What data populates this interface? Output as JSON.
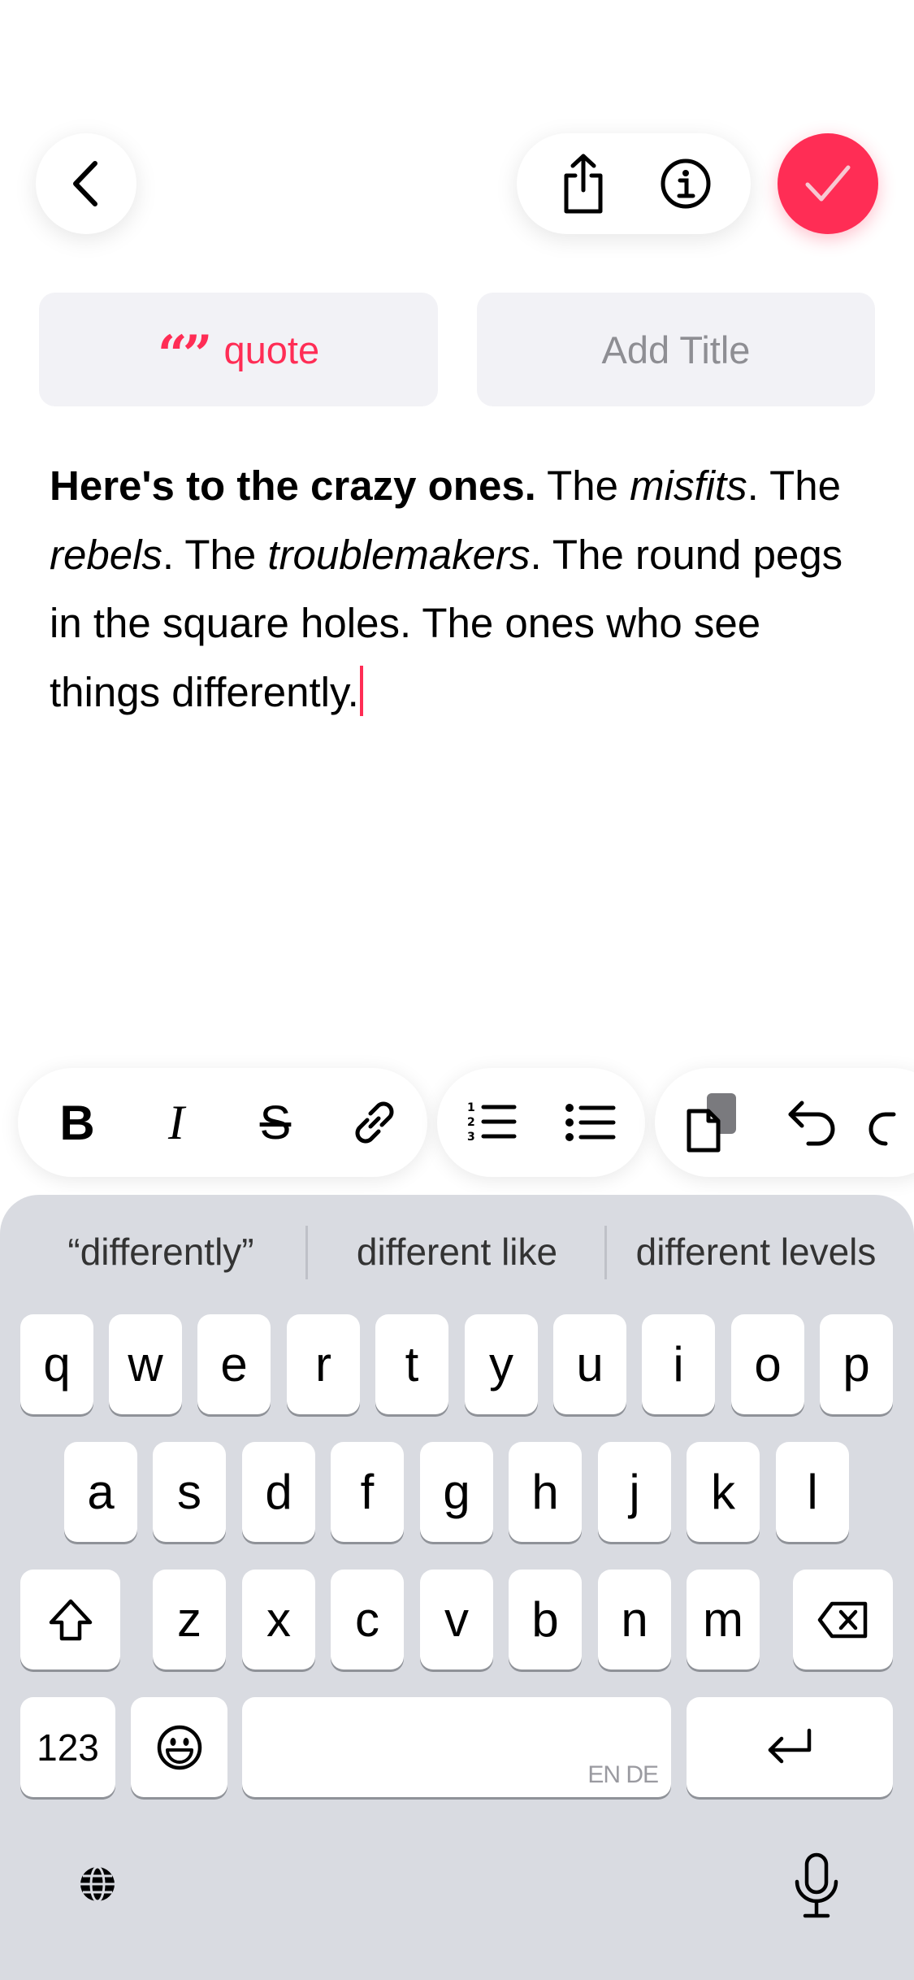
{
  "header": {
    "back_icon": "chevron-left-icon",
    "share_icon": "share-icon",
    "info_icon": "info-icon",
    "done_icon": "checkmark-icon",
    "accent": "#ff2d55"
  },
  "chips": {
    "quote_label": "quote",
    "title_placeholder": "Add Title"
  },
  "note": {
    "bold_text": "Here's to the crazy ones.",
    "t1": " The ",
    "i1": "misfits",
    "t2": ". The ",
    "i2": "rebels",
    "t3": ". The ",
    "i3": "troublemakers",
    "t4": ". The round pegs in the square holes. The ones who see things differently."
  },
  "toolbar": {
    "bold_label": "B",
    "italic_label": "I",
    "strike_label": "S",
    "items": [
      "bold-icon",
      "italic-icon",
      "strikethrough-icon",
      "link-icon",
      "numbered-list-icon",
      "bulleted-list-icon",
      "paste-icon",
      "undo-icon",
      "redo-icon"
    ]
  },
  "keyboard": {
    "suggestions": [
      "“differently”",
      "different like",
      "different levels"
    ],
    "row1": [
      "q",
      "w",
      "e",
      "r",
      "t",
      "y",
      "u",
      "i",
      "o",
      "p"
    ],
    "row2": [
      "a",
      "s",
      "d",
      "f",
      "g",
      "h",
      "j",
      "k",
      "l"
    ],
    "row3": [
      "z",
      "x",
      "c",
      "v",
      "b",
      "n",
      "m"
    ],
    "numbers_label": "123",
    "space_lang": "EN DE",
    "icons": [
      "shift-icon",
      "backspace-icon",
      "emoji-icon",
      "return-icon",
      "globe-icon",
      "microphone-icon"
    ]
  }
}
